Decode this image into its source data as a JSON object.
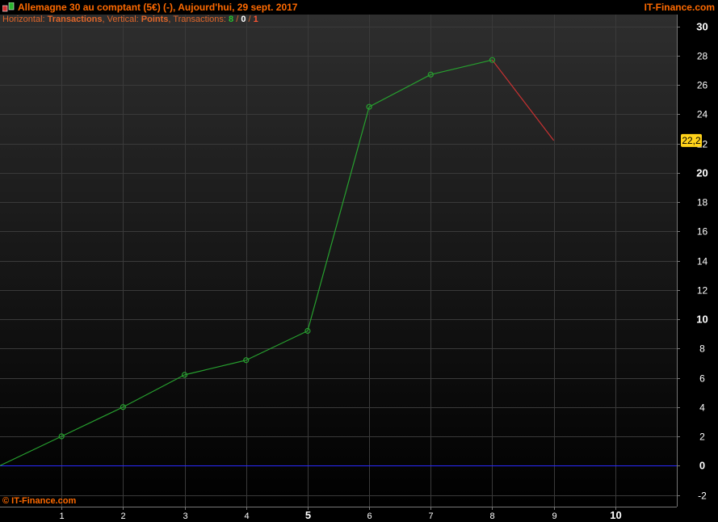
{
  "window": {
    "title": "Allemagne 30 au comptant (5€) (-), Aujourd'hui, 29 sept. 2017",
    "brand": "IT-Finance.com"
  },
  "info": {
    "horizontal_label": "Horizontal: ",
    "horizontal_value": "Transactions",
    "vertical_label": ", Vertical: ",
    "vertical_value": "Points",
    "transactions_label": ", Transactions: ",
    "wins": "8",
    "sep1": " / ",
    "flat": "0",
    "sep2": " / ",
    "losses": "1"
  },
  "copyright": "© IT-Finance.com",
  "colors": {
    "background_top": "#2e2e2e",
    "background_bottom": "#000000",
    "accent": "#ff6a00",
    "win_line": "#27a02f",
    "loss_line": "#c83232",
    "zero_line": "#2a2aff",
    "current_badge": "#ffd21a"
  },
  "chart_data": {
    "type": "line",
    "x": [
      0,
      1,
      2,
      3,
      4,
      5,
      6,
      7,
      8,
      9
    ],
    "y": [
      0,
      2,
      4,
      6.2,
      7.2,
      9.2,
      24.5,
      26.7,
      27.7,
      22.2
    ],
    "segment_results": [
      "win",
      "win",
      "win",
      "win",
      "win",
      "win",
      "win",
      "win",
      "loss"
    ],
    "markers": true,
    "xlim": [
      0,
      11
    ],
    "ylim": [
      -2.8,
      30.8
    ],
    "x_ticks": [
      "1",
      "2",
      "3",
      "4",
      "5",
      "6",
      "7",
      "8",
      "9",
      "10"
    ],
    "x_ticks_bold": [
      "5",
      "10"
    ],
    "y_ticks": [
      "-2",
      "0",
      "2",
      "4",
      "6",
      "8",
      "10",
      "12",
      "14",
      "16",
      "18",
      "20",
      "22",
      "24",
      "26",
      "28",
      "30"
    ],
    "y_ticks_bold": [
      "0",
      "10",
      "20",
      "30"
    ],
    "zero_line": 0,
    "current_value_label": "22,2",
    "current_value": 22.2,
    "grid": true,
    "xlabel": "",
    "ylabel": ""
  }
}
